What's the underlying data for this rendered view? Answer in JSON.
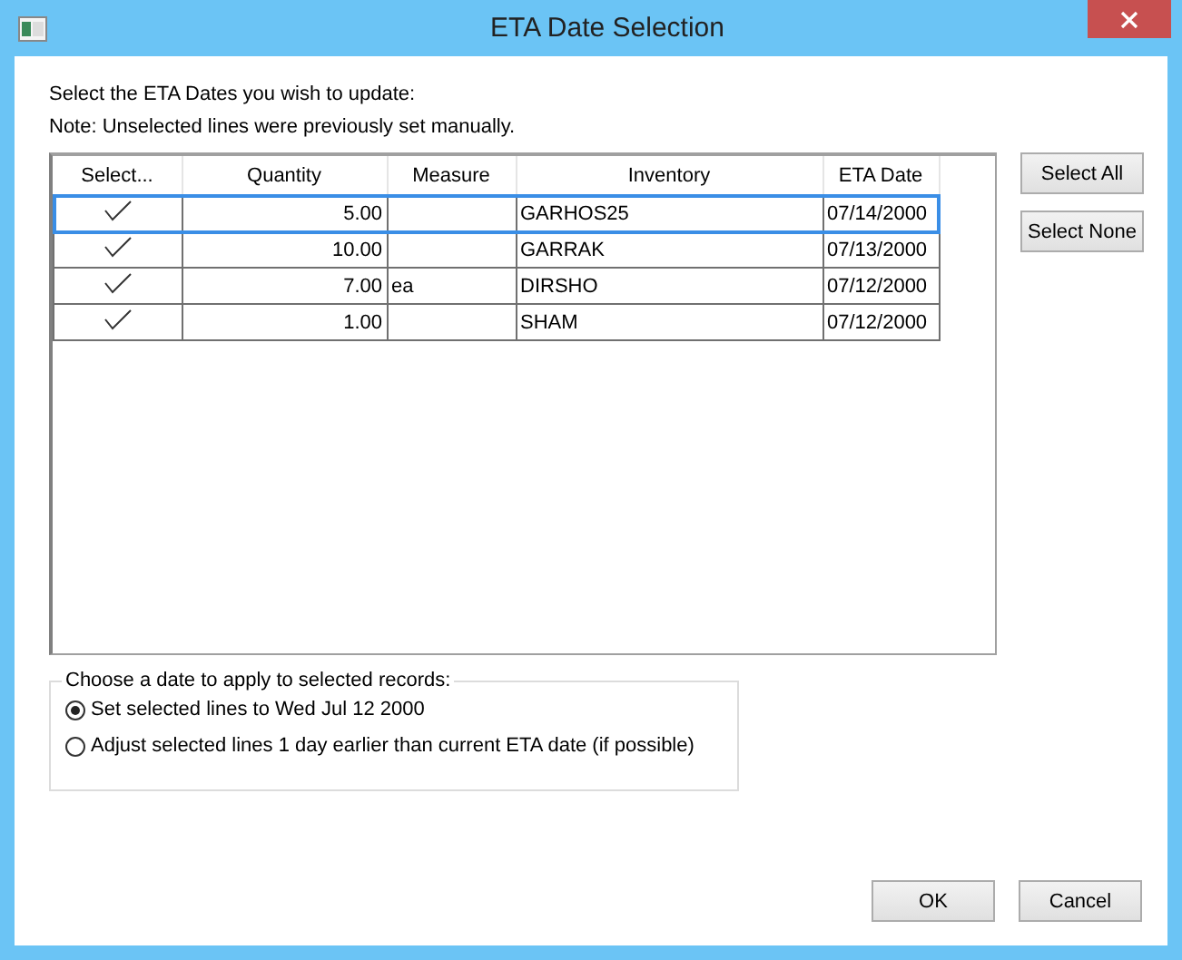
{
  "window": {
    "title": "ETA Date Selection"
  },
  "intro": [
    "Select the ETA Dates you wish to update:",
    "Note: Unselected lines were previously set manually."
  ],
  "table": {
    "columns": [
      "Select...",
      "Quantity",
      "Measure",
      "Inventory",
      "ETA Date"
    ],
    "rows": [
      {
        "checked": true,
        "selected": true,
        "quantity": "5.00",
        "measure": "",
        "inventory": "GARHOS25",
        "eta": "07/14/2000"
      },
      {
        "checked": true,
        "selected": false,
        "quantity": "10.00",
        "measure": "",
        "inventory": "GARRAK",
        "eta": "07/13/2000"
      },
      {
        "checked": true,
        "selected": false,
        "quantity": "7.00",
        "measure": "ea",
        "inventory": "DIRSHO",
        "eta": "07/12/2000"
      },
      {
        "checked": true,
        "selected": false,
        "quantity": "1.00",
        "measure": "",
        "inventory": "SHAM",
        "eta": "07/12/2000"
      }
    ]
  },
  "side_buttons": [
    "Select All",
    "Select None"
  ],
  "date_group": {
    "title": "Choose a date to apply to selected records:",
    "options": [
      {
        "label": "Set selected lines to Wed Jul 12 2000",
        "selected": true
      },
      {
        "label": "Adjust selected lines 1 day earlier than current ETA date (if possible)",
        "selected": false
      }
    ]
  },
  "buttons": [
    "OK",
    "Cancel"
  ]
}
